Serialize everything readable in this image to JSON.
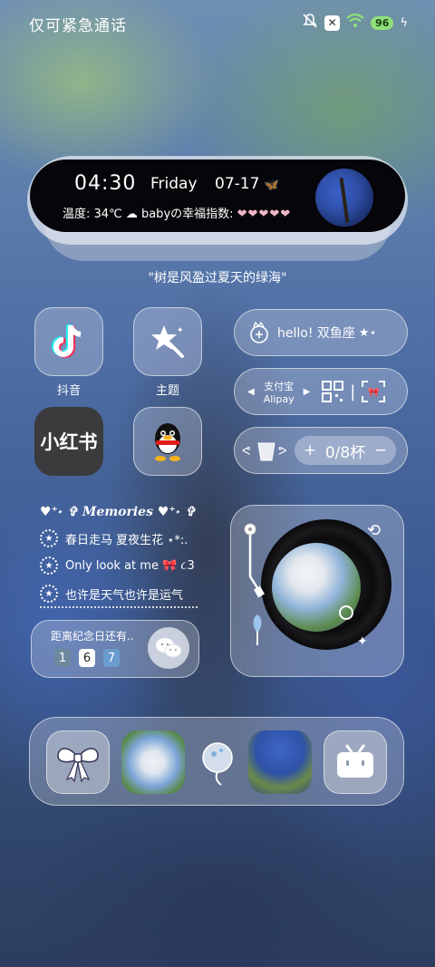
{
  "status_bar": {
    "carrier_text": "仅可紧急通话",
    "icons": [
      "mute-icon",
      "sim-off-icon",
      "wifi-icon",
      "battery-icon",
      "charging-icon"
    ],
    "battery": "96"
  },
  "top_widget": {
    "time": "04:30",
    "day": "Friday",
    "date": "07-17",
    "date_deco": "🦋",
    "temperature_label": "温度:",
    "temperature": "34℃",
    "weather_icon": "cloud-icon",
    "happiness_label": "babyの幸福指数:",
    "hearts": "❤❤❤❤❤"
  },
  "quote": "\"树是风盈过夏天的绿海\"",
  "apps": [
    {
      "name": "抖音",
      "icon": "douyin-icon"
    },
    {
      "name": "主题",
      "icon": "theme-icon"
    },
    {
      "name": "",
      "icon": "xiaohongshu-icon",
      "text": "小红书"
    },
    {
      "name": "",
      "icon": "qq-icon"
    }
  ],
  "hello_widget": {
    "text": "hello! 双鱼座"
  },
  "alipay_widget": {
    "name_cn": "支付宝",
    "name_en": "Alipay",
    "separator": "|"
  },
  "water_widget": {
    "plus": "+",
    "count": "0/8杯",
    "minus": "−"
  },
  "memories": {
    "title": "Memories",
    "items": [
      "春日走马 夏夜生花 ⋆*:.",
      "Only look at me 🎀 ૮3",
      "也许是天气也许是运气"
    ],
    "countdown_label": "距离纪念日还有..",
    "digits": [
      "1",
      "6",
      "7"
    ]
  },
  "colors": {
    "accent": "#ffffff",
    "widget_black": "#06060a",
    "glass": "rgba(225,230,240,0.28)",
    "digit_blue": "#4f7fa6"
  },
  "dock": {
    "icons": [
      "bow-icon",
      "flower-photo-icon",
      "decor-icon",
      "tree-photo-icon",
      "bilibili-icon"
    ]
  }
}
